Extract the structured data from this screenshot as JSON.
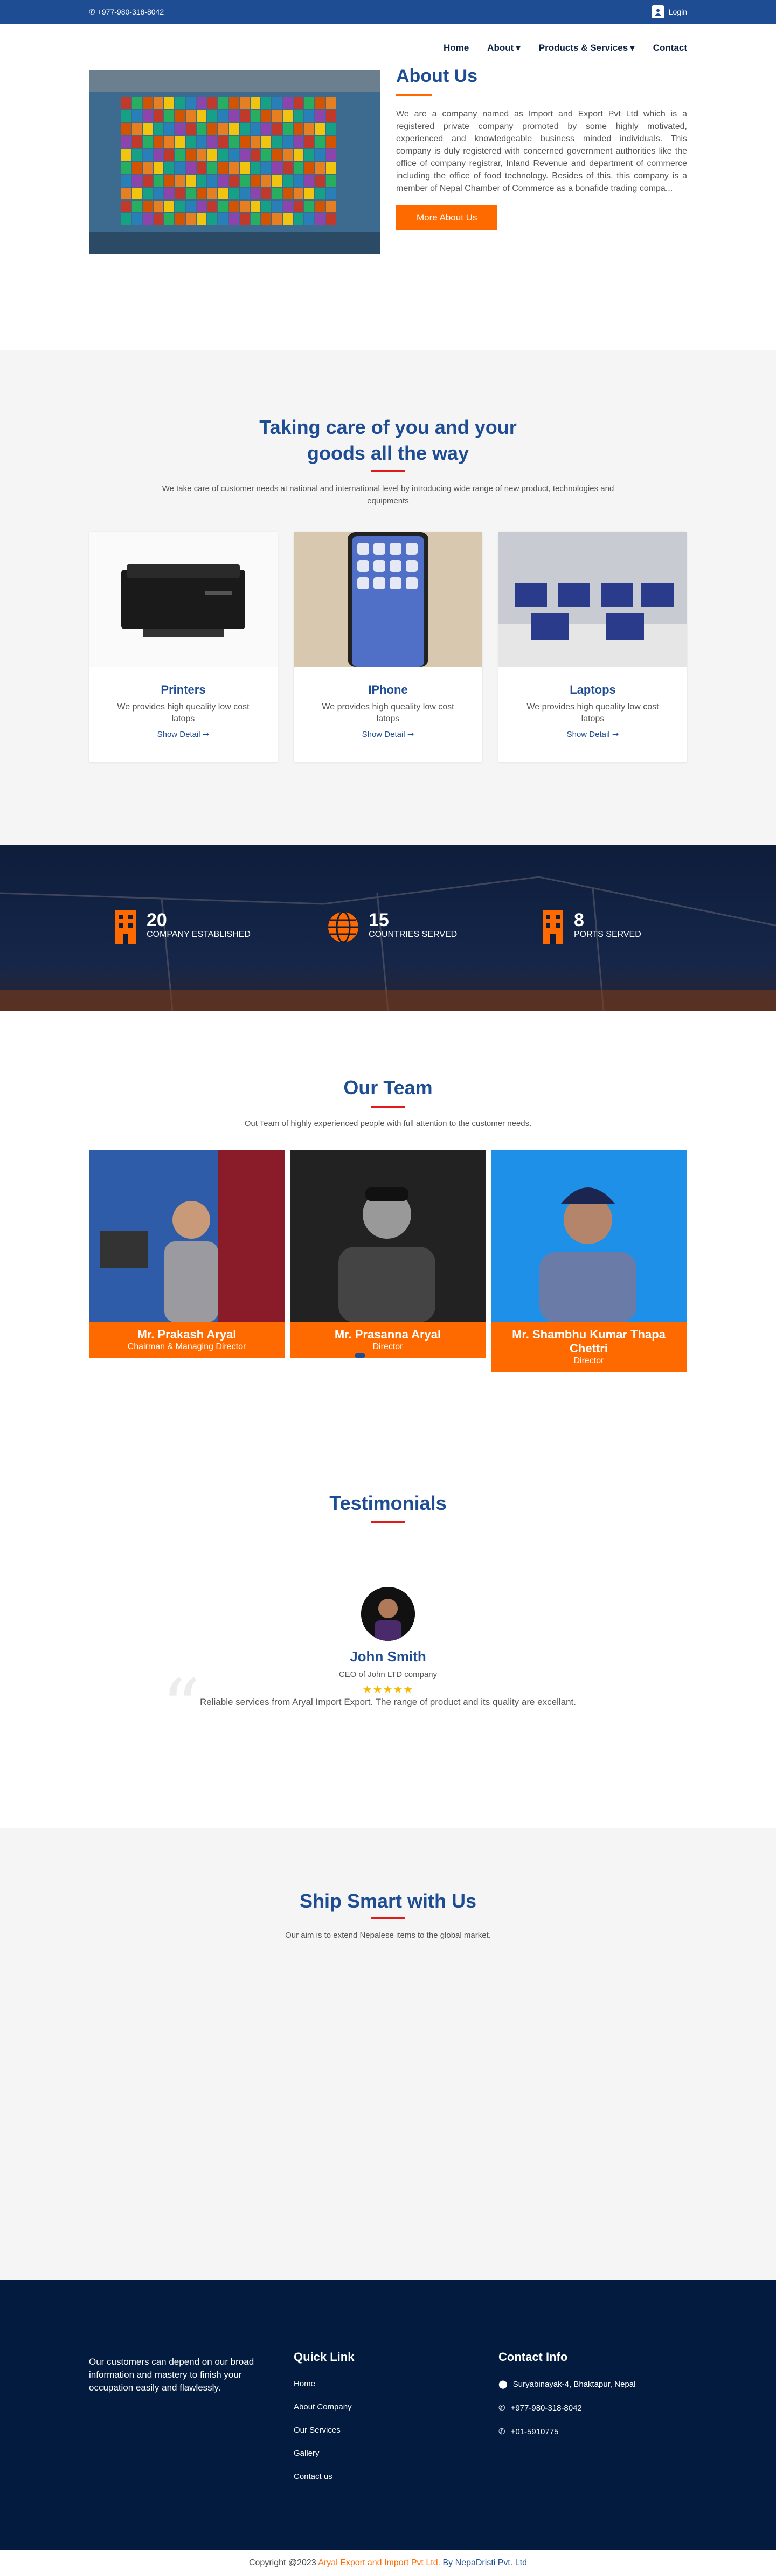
{
  "topbar": {
    "phone": "+977-980-318-8042",
    "login": "Login"
  },
  "nav": [
    {
      "label": "Home",
      "caret": false
    },
    {
      "label": "About",
      "caret": true
    },
    {
      "label": "Products & Services",
      "caret": true
    },
    {
      "label": "Contact",
      "caret": false
    }
  ],
  "about": {
    "title": "About Us",
    "body": "We are a company named as Import and Export Pvt Ltd which is a registered private company promoted by some highly motivated, experienced and knowledgeable business minded individuals. This company is duly registered with concerned government authorities like the office of company registrar, Inland Revenue and department of commerce including the office of food technology. Besides of this, this company is a member of Nepal Chamber of Commerce as a bonafide trading compa...",
    "button": "More About Us"
  },
  "products": {
    "title": "Taking care of you and your goods all the way",
    "subtitle": "We take care of customer needs at national and international level by introducing wide range of new product, technologies and equipments",
    "items": [
      {
        "name": "Printers",
        "desc": "We provides high queality low cost latops",
        "link": "Show Detail"
      },
      {
        "name": "IPhone",
        "desc": "We provides high queality low cost latops",
        "link": "Show Detail"
      },
      {
        "name": "Laptops",
        "desc": "We provides high queality low cost latops",
        "link": "Show Detail"
      }
    ]
  },
  "stats": [
    {
      "value": "20",
      "label": "COMPANY ESTABLISHED"
    },
    {
      "value": "15",
      "label": "COUNTRIES SERVED"
    },
    {
      "value": "8",
      "label": "PORTS SERVED"
    }
  ],
  "team": {
    "title": "Our Team",
    "subtitle": "Out Team of highly experienced people with full attention to the customer needs.",
    "members": [
      {
        "name": "Mr. Prakash Aryal",
        "role": "Chairman & Managing Director"
      },
      {
        "name": "Mr. Prasanna Aryal",
        "role": "Director"
      },
      {
        "name": "Mr. Shambhu Kumar Thapa Chettri",
        "role": "Director"
      }
    ]
  },
  "testimonials": {
    "title": "Testimonials",
    "name": "John Smith",
    "role": "CEO of John LTD company",
    "stars": "★★★★★",
    "quote": "Reliable services from Aryal Import Export. The range of product and its quality are excellant."
  },
  "ship": {
    "title": "Ship Smart with Us",
    "subtitle": "Our aim is to extend Nepalese items to the global market."
  },
  "footer": {
    "about": "Our customers can depend on our broad information and mastery to finish your occupation easily and flawlessly.",
    "quick_title": "Quick Link",
    "quick_links": [
      "Home",
      "About Company",
      "Our Services",
      "Gallery",
      "Contact us"
    ],
    "contact_title": "Contact Info",
    "address": "Suryabinayak-4, Bhaktapur, Nepal",
    "phone1": "+977-980-318-8042",
    "phone2": "+01-5910775"
  },
  "copyright": {
    "prefix": "Copyright @2023 ",
    "company": "Aryal Export and Import Pvt Ltd.",
    "by": " By ",
    "dev": "NepaDristi Pvt. Ltd"
  },
  "colors": {
    "primary": "#1f4d93",
    "accent": "#ff6a00",
    "dark": "#021b3e"
  }
}
